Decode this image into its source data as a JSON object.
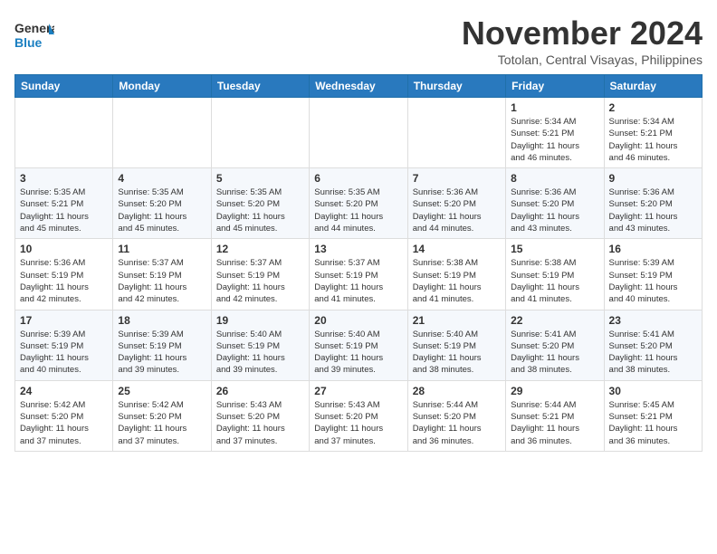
{
  "header": {
    "logo_general": "General",
    "logo_blue": "Blue",
    "month": "November 2024",
    "location": "Totolan, Central Visayas, Philippines"
  },
  "weekdays": [
    "Sunday",
    "Monday",
    "Tuesday",
    "Wednesday",
    "Thursday",
    "Friday",
    "Saturday"
  ],
  "weeks": [
    {
      "days": [
        {
          "num": "",
          "info": ""
        },
        {
          "num": "",
          "info": ""
        },
        {
          "num": "",
          "info": ""
        },
        {
          "num": "",
          "info": ""
        },
        {
          "num": "",
          "info": ""
        },
        {
          "num": "1",
          "info": "Sunrise: 5:34 AM\nSunset: 5:21 PM\nDaylight: 11 hours\nand 46 minutes."
        },
        {
          "num": "2",
          "info": "Sunrise: 5:34 AM\nSunset: 5:21 PM\nDaylight: 11 hours\nand 46 minutes."
        }
      ]
    },
    {
      "days": [
        {
          "num": "3",
          "info": "Sunrise: 5:35 AM\nSunset: 5:21 PM\nDaylight: 11 hours\nand 45 minutes."
        },
        {
          "num": "4",
          "info": "Sunrise: 5:35 AM\nSunset: 5:20 PM\nDaylight: 11 hours\nand 45 minutes."
        },
        {
          "num": "5",
          "info": "Sunrise: 5:35 AM\nSunset: 5:20 PM\nDaylight: 11 hours\nand 45 minutes."
        },
        {
          "num": "6",
          "info": "Sunrise: 5:35 AM\nSunset: 5:20 PM\nDaylight: 11 hours\nand 44 minutes."
        },
        {
          "num": "7",
          "info": "Sunrise: 5:36 AM\nSunset: 5:20 PM\nDaylight: 11 hours\nand 44 minutes."
        },
        {
          "num": "8",
          "info": "Sunrise: 5:36 AM\nSunset: 5:20 PM\nDaylight: 11 hours\nand 43 minutes."
        },
        {
          "num": "9",
          "info": "Sunrise: 5:36 AM\nSunset: 5:20 PM\nDaylight: 11 hours\nand 43 minutes."
        }
      ]
    },
    {
      "days": [
        {
          "num": "10",
          "info": "Sunrise: 5:36 AM\nSunset: 5:19 PM\nDaylight: 11 hours\nand 42 minutes."
        },
        {
          "num": "11",
          "info": "Sunrise: 5:37 AM\nSunset: 5:19 PM\nDaylight: 11 hours\nand 42 minutes."
        },
        {
          "num": "12",
          "info": "Sunrise: 5:37 AM\nSunset: 5:19 PM\nDaylight: 11 hours\nand 42 minutes."
        },
        {
          "num": "13",
          "info": "Sunrise: 5:37 AM\nSunset: 5:19 PM\nDaylight: 11 hours\nand 41 minutes."
        },
        {
          "num": "14",
          "info": "Sunrise: 5:38 AM\nSunset: 5:19 PM\nDaylight: 11 hours\nand 41 minutes."
        },
        {
          "num": "15",
          "info": "Sunrise: 5:38 AM\nSunset: 5:19 PM\nDaylight: 11 hours\nand 41 minutes."
        },
        {
          "num": "16",
          "info": "Sunrise: 5:39 AM\nSunset: 5:19 PM\nDaylight: 11 hours\nand 40 minutes."
        }
      ]
    },
    {
      "days": [
        {
          "num": "17",
          "info": "Sunrise: 5:39 AM\nSunset: 5:19 PM\nDaylight: 11 hours\nand 40 minutes."
        },
        {
          "num": "18",
          "info": "Sunrise: 5:39 AM\nSunset: 5:19 PM\nDaylight: 11 hours\nand 39 minutes."
        },
        {
          "num": "19",
          "info": "Sunrise: 5:40 AM\nSunset: 5:19 PM\nDaylight: 11 hours\nand 39 minutes."
        },
        {
          "num": "20",
          "info": "Sunrise: 5:40 AM\nSunset: 5:19 PM\nDaylight: 11 hours\nand 39 minutes."
        },
        {
          "num": "21",
          "info": "Sunrise: 5:40 AM\nSunset: 5:19 PM\nDaylight: 11 hours\nand 38 minutes."
        },
        {
          "num": "22",
          "info": "Sunrise: 5:41 AM\nSunset: 5:20 PM\nDaylight: 11 hours\nand 38 minutes."
        },
        {
          "num": "23",
          "info": "Sunrise: 5:41 AM\nSunset: 5:20 PM\nDaylight: 11 hours\nand 38 minutes."
        }
      ]
    },
    {
      "days": [
        {
          "num": "24",
          "info": "Sunrise: 5:42 AM\nSunset: 5:20 PM\nDaylight: 11 hours\nand 37 minutes."
        },
        {
          "num": "25",
          "info": "Sunrise: 5:42 AM\nSunset: 5:20 PM\nDaylight: 11 hours\nand 37 minutes."
        },
        {
          "num": "26",
          "info": "Sunrise: 5:43 AM\nSunset: 5:20 PM\nDaylight: 11 hours\nand 37 minutes."
        },
        {
          "num": "27",
          "info": "Sunrise: 5:43 AM\nSunset: 5:20 PM\nDaylight: 11 hours\nand 37 minutes."
        },
        {
          "num": "28",
          "info": "Sunrise: 5:44 AM\nSunset: 5:20 PM\nDaylight: 11 hours\nand 36 minutes."
        },
        {
          "num": "29",
          "info": "Sunrise: 5:44 AM\nSunset: 5:21 PM\nDaylight: 11 hours\nand 36 minutes."
        },
        {
          "num": "30",
          "info": "Sunrise: 5:45 AM\nSunset: 5:21 PM\nDaylight: 11 hours\nand 36 minutes."
        }
      ]
    }
  ]
}
